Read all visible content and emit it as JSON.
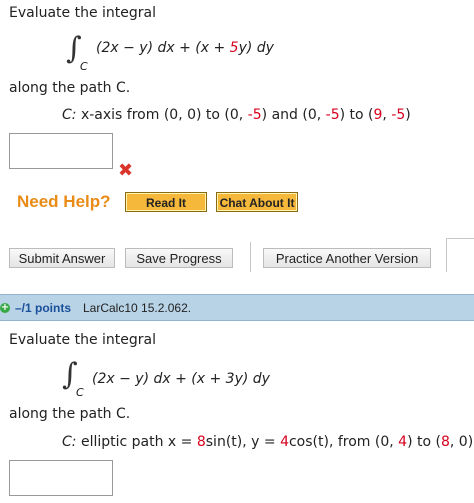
{
  "problem1": {
    "heading": "Evaluate the integral",
    "integral_symbol": "∫",
    "integral_subscript": "C",
    "integrand": {
      "p1": "(2x − y) dx + (x + ",
      "coef": "5",
      "p2": "y) dy"
    },
    "along": "along the path C.",
    "path": {
      "label": "C:",
      "p1": "x-axis from (0, 0) to (0, ",
      "v1": "-5",
      "p2": ") and (0, ",
      "v2": "-5",
      "p3": ") to (",
      "v3": "9",
      "p4": ", ",
      "v4": "-5",
      "p5": ")"
    },
    "answer_value": ""
  },
  "help": {
    "label": "Need Help?",
    "read_it": "Read It",
    "chat_about_it": "Chat About It"
  },
  "actions": {
    "submit": "Submit Answer",
    "save": "Save Progress",
    "practice": "Practice Another Version"
  },
  "points_bar": {
    "plus": "+",
    "points": "–/1 points",
    "reference": "LarCalc10 15.2.062."
  },
  "problem2": {
    "heading": "Evaluate the integral",
    "integral_symbol": "∫",
    "integral_subscript": "C",
    "integrand": "(2x − y) dx + (x + 3y) dy",
    "along": "along the path C.",
    "path": {
      "label": "C:",
      "p1": "elliptic path x = ",
      "v1": "8",
      "p2": "sin(t), y = ",
      "v2": "4",
      "p3": "cos(t), from (0, ",
      "v3": "4",
      "p4": ") to (",
      "v4": "8",
      "p5": ", 0)"
    },
    "answer_value": ""
  },
  "colors": {
    "accent_red": "#d6001c",
    "need_help_orange": "#e98b16",
    "help_button": "#f6b83a",
    "points_bar": "#b8d2e6",
    "points_text": "#1a4f9a"
  }
}
